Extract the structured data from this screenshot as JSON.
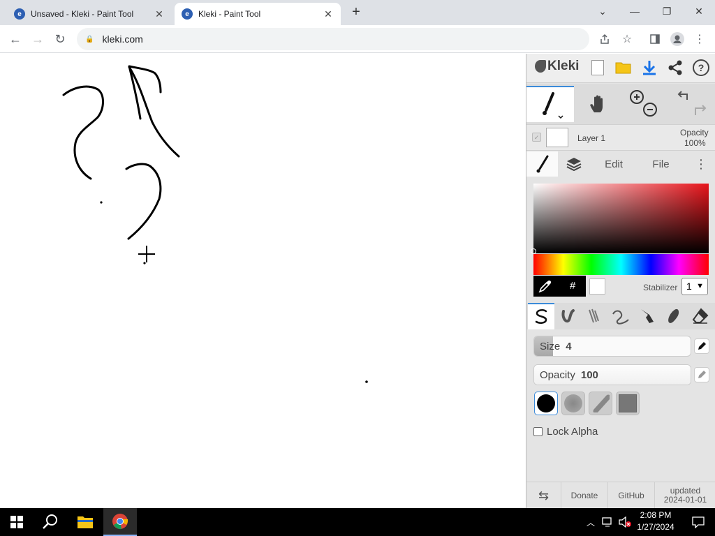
{
  "browser": {
    "tabs": [
      {
        "title": "Unsaved - Kleki - Paint Tool",
        "active": false
      },
      {
        "title": "Kleki - Paint Tool",
        "active": true
      }
    ],
    "url": "kleki.com"
  },
  "panel": {
    "logo": "Kleki",
    "layer": {
      "name": "Layer 1",
      "opacity_label": "Opacity",
      "opacity_value": "100%"
    },
    "tabs": {
      "edit": "Edit",
      "file": "File"
    },
    "color": {
      "hash": "#",
      "current": "#ffffff",
      "hue": "#e8141b"
    },
    "stabilizer": {
      "label": "Stabilizer",
      "value": "1"
    },
    "size": {
      "label": "Size",
      "value": "4",
      "level": 0.12
    },
    "opacity": {
      "label": "Opacity",
      "value": "100",
      "level": 1.0
    },
    "lock_alpha": "Lock Alpha",
    "footer": {
      "donate": "Donate",
      "github": "GitHub",
      "updated_line1": "updated",
      "updated_line2": "2024-01-01"
    }
  },
  "taskbar": {
    "time": "2:08 PM",
    "date": "1/27/2024"
  },
  "colors": {
    "accent": "#3c8bd9",
    "download": "#1a73e8",
    "folder": "#f5c518"
  }
}
